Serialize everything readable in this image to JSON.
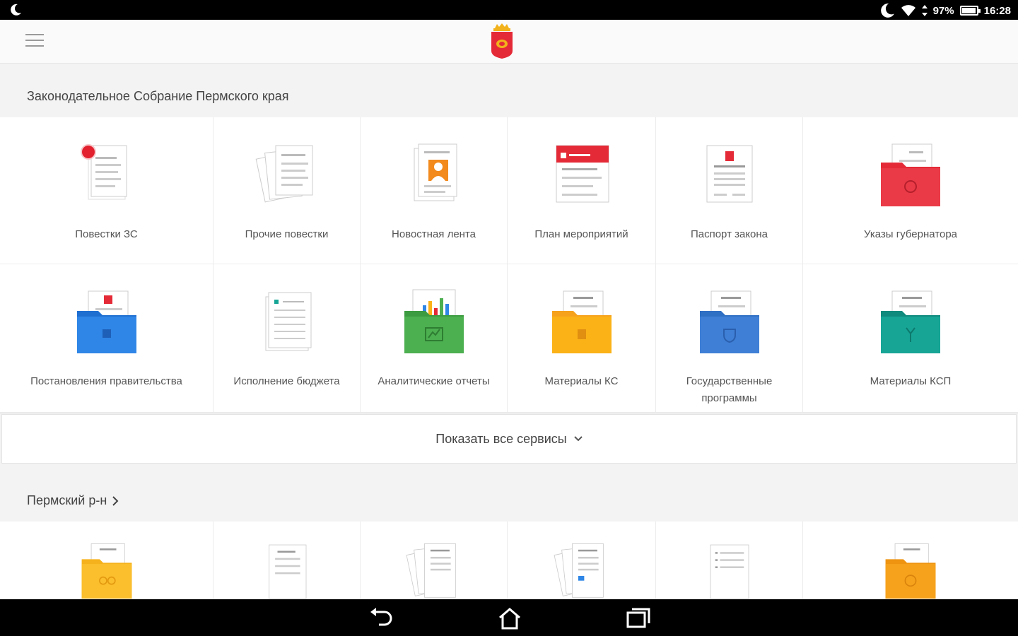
{
  "status_bar": {
    "battery": "97%",
    "time": "16:28"
  },
  "app_bar": {
    "menu_icon": "hamburger-menu-icon",
    "logo": "perm-krai-coat-of-arms"
  },
  "section1": {
    "title": "Законодательное Собрание Пермского края",
    "tiles": [
      {
        "label": "Повестки ЗС",
        "icon": "document-stack-icon",
        "badge": true
      },
      {
        "label": "Прочие повестки",
        "icon": "fanned-documents-icon"
      },
      {
        "label": "Новостная лента",
        "icon": "news-document-icon"
      },
      {
        "label": "План мероприятий",
        "icon": "calendar-document-icon"
      },
      {
        "label": "Паспорт закона",
        "icon": "law-passport-icon"
      },
      {
        "label": "Указы губернатора",
        "icon": "red-folder-icon"
      },
      {
        "label": "Постановления правительства",
        "icon": "blue-folder-icon"
      },
      {
        "label": "Исполнение бюджета",
        "icon": "budget-document-icon"
      },
      {
        "label": "Аналитические отчеты",
        "icon": "green-chart-folder-icon"
      },
      {
        "label": "Материалы КС",
        "icon": "yellow-folder-icon"
      },
      {
        "label": "Государственные программы",
        "icon": "blue-program-folder-icon"
      },
      {
        "label": "Материалы КСП",
        "icon": "teal-folder-icon"
      }
    ],
    "show_all": "Показать все сервисы"
  },
  "section2": {
    "title": "Пермский р-н",
    "tiles": [
      {
        "icon": "yellow-people-folder-icon"
      },
      {
        "icon": "document-icon"
      },
      {
        "icon": "fanned-documents-icon"
      },
      {
        "icon": "fanned-documents-icon"
      },
      {
        "icon": "document-list-icon"
      },
      {
        "icon": "orange-question-folder-icon"
      }
    ]
  },
  "colors": {
    "red": "#e52a37",
    "blue": "#2f86e6",
    "green": "#4caf50",
    "yellow": "#fbb217",
    "teal": "#17a596",
    "program_blue": "#3f7fd6",
    "orange": "#f6a21c"
  }
}
